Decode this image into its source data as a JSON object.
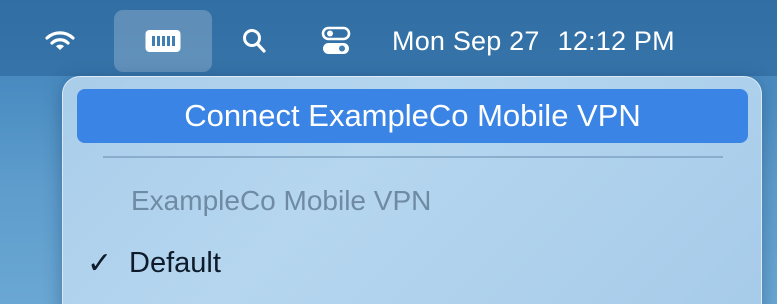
{
  "menubar": {
    "icons": {
      "wifi": "wifi-icon",
      "vpn": "vpn-menu-extra-icon",
      "search": "search-icon",
      "control_center": "control-center-icon"
    },
    "date": "Mon Sep 27",
    "time": "12:12 PM"
  },
  "vpn_menu": {
    "connect_label": "Connect ExampleCo Mobile VPN",
    "section_header": "ExampleCo Mobile VPN",
    "check_mark": "✓",
    "default_label": "Default"
  },
  "colors": {
    "highlight": "#3a84e6",
    "menu_background": "#b0d2ec",
    "disabled_text": "#6f8aa3"
  }
}
